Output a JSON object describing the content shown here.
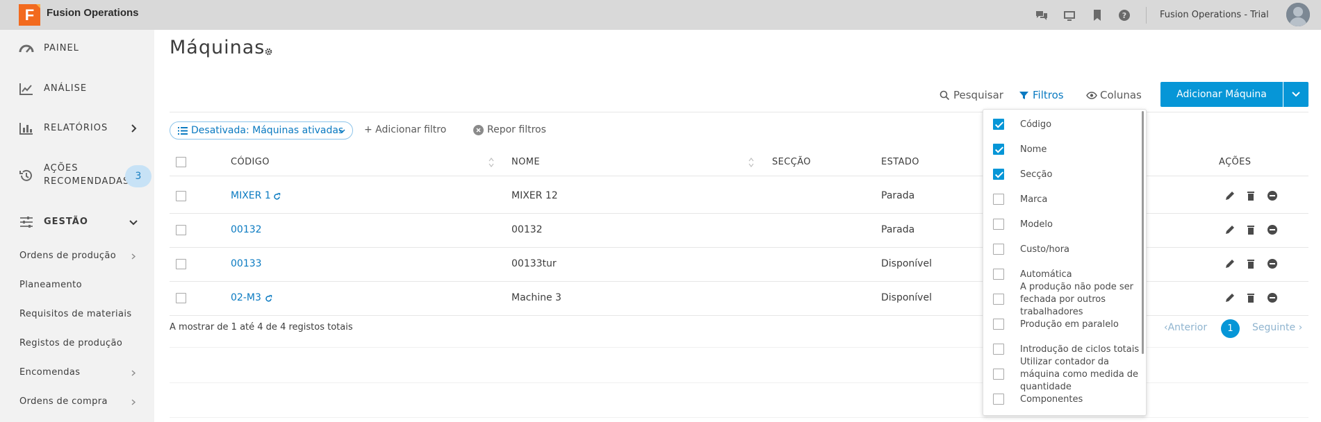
{
  "topbar": {
    "logo_letter": "F",
    "app_title": "Fusion Operations",
    "tenant": "Fusion Operations - Trial",
    "icons": [
      "chat-icon",
      "tv-icon",
      "bookmark-icon",
      "help-icon"
    ]
  },
  "sidebar": {
    "painel": "PAINEL",
    "analise": "ANÁLISE",
    "relatorios": "RELATÓRIOS",
    "acoes_line1": "AÇÕES",
    "acoes_line2": "RECOMENDADAS",
    "acoes_badge": "3",
    "gestao": "GESTÃO",
    "sub": [
      "Ordens de produção",
      "Planeamento",
      "Requisitos de materiais",
      "Registos de produção",
      "Encomendas",
      "Ordens de compra"
    ]
  },
  "page": {
    "title": "Máquinas"
  },
  "toolbar": {
    "search": "Pesquisar",
    "filters": "Filtros",
    "columns": "Colunas",
    "add": "Adicionar Máquina"
  },
  "filterbar": {
    "chip": "Desativada: Máquinas ativadas",
    "add_filter": "+ Adicionar filtro",
    "reset": "Repor filtros"
  },
  "table": {
    "headers": {
      "code": "CÓDIGO",
      "name": "NOME",
      "section": "SECÇÃO",
      "state": "ESTADO",
      "actions": "AÇÕES"
    },
    "rows": [
      {
        "code": "MIXER 1",
        "name": "MIXER 12",
        "state": "Parada"
      },
      {
        "code": "00132",
        "name": "00132",
        "state": "Parada"
      },
      {
        "code": "00133",
        "name": "00133tur",
        "state": "Disponível"
      },
      {
        "code": "02-M3",
        "name": "Machine 3",
        "state": "Disponível"
      }
    ]
  },
  "footer": {
    "summary": "A mostrar de 1 até 4 de 4 registos totais",
    "prev": "Anterior",
    "page": "1",
    "next": "Seguinte"
  },
  "column_chooser": {
    "items": [
      {
        "label": "Código",
        "checked": true
      },
      {
        "label": "Nome",
        "checked": true
      },
      {
        "label": "Secção",
        "checked": true
      },
      {
        "label": "Marca",
        "checked": false
      },
      {
        "label": "Modelo",
        "checked": false
      },
      {
        "label": "Custo/hora",
        "checked": false
      },
      {
        "label": "Automática",
        "checked": false
      },
      {
        "label": "A produção não pode ser fechada por outros trabalhadores",
        "checked": false
      },
      {
        "label": "Produção em paralelo",
        "checked": false
      },
      {
        "label": "Introdução de ciclos totais",
        "checked": false
      },
      {
        "label": "Utilizar contador da máquina como medida de quantidade",
        "checked": false
      },
      {
        "label": "Componentes",
        "checked": false
      }
    ]
  },
  "colors": {
    "accent": "#0696d7",
    "link": "#0a7ac1",
    "sidebar_bg": "#f2f2f2",
    "topbar_bg": "#d9d9d9",
    "logo": "#f26a1e"
  }
}
